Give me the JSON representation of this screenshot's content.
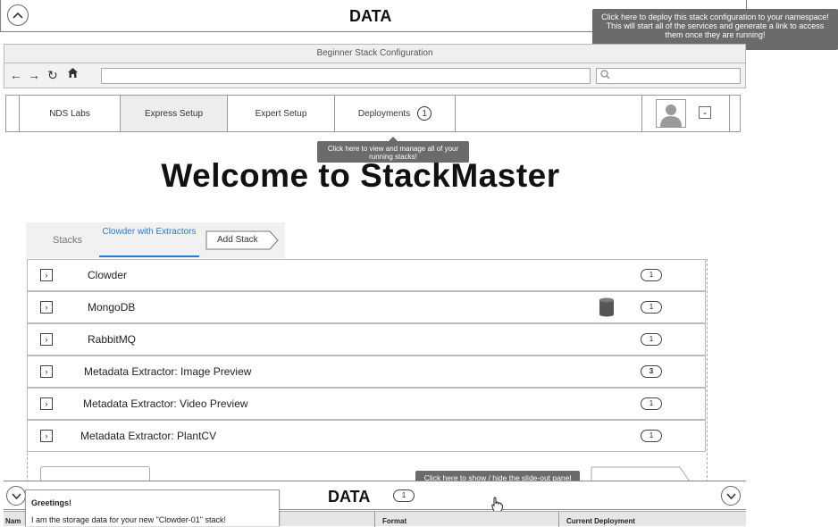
{
  "top": {
    "title": "DATA",
    "collapse_icon": "chevron-up-icon"
  },
  "tooltips": {
    "deploy": "Click here to deploy this stack configuration to your namespace! This will start all of the services and generate a link to access them once they are running!",
    "deployments": "Click here to view and manage all of your running stacks!",
    "slideout": "Click here to show / hide the slide-out panel containing your storage data"
  },
  "window": {
    "title": "Beginner Stack Configuration"
  },
  "browser": {
    "back_icon": "back-arrow-icon",
    "forward_icon": "forward-arrow-icon",
    "reload_icon": "reload-icon",
    "home_icon": "home-icon",
    "url_value": "",
    "search_icon": "search-icon"
  },
  "nav": {
    "items": [
      {
        "label": "NDS Labs"
      },
      {
        "label": "Express Setup"
      },
      {
        "label": "Expert Setup"
      },
      {
        "label": "Deployments",
        "badge": "1"
      }
    ],
    "avatar_icon": "user-avatar-icon",
    "dropdown_icon": "chevron-down-icon"
  },
  "main": {
    "heading": "Welcome to StackMaster"
  },
  "stack_tabs": {
    "stacks": "Stacks",
    "clowder": "Clowder with Extractors",
    "add_stack": "Add Stack"
  },
  "services": [
    {
      "name": "Clowder",
      "count": "1",
      "has_storage": false
    },
    {
      "name": "MongoDB",
      "count": "1",
      "has_storage": true
    },
    {
      "name": "RabbitMQ",
      "count": "1",
      "has_storage": false
    },
    {
      "name": "Metadata Extractor: Image Preview",
      "count": "3",
      "has_storage": false
    },
    {
      "name": "Metadata Extractor: Video Preview",
      "count": "1",
      "has_storage": false
    },
    {
      "name": "Metadata Extractor: PlantCV",
      "count": "1",
      "has_storage": false
    }
  ],
  "bottom": {
    "title": "DATA",
    "badge": "1",
    "greeting_title": "Greetings!",
    "greeting_text": "I am the storage data for your new \"Clowder-01\" stack!",
    "columns": {
      "name": "Nam",
      "format": "Format",
      "deployment": "Current Deployment"
    }
  }
}
